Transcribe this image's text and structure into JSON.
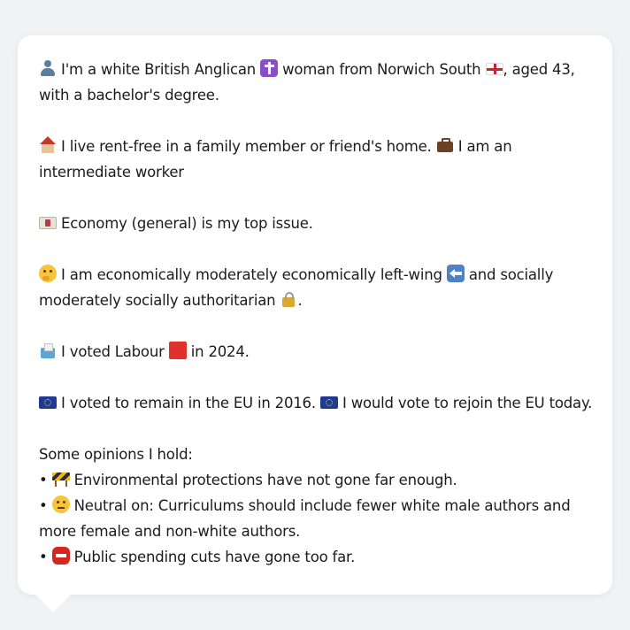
{
  "profile": {
    "identity": {
      "icon": "person-icon",
      "text_a": "I'm a white British Anglican",
      "religion_icon": "latin-cross-icon",
      "text_b": "woman from Norwich South",
      "flag_icon": "england-flag-icon",
      "text_c": ", aged 43, with a bachelor's degree."
    },
    "housing": {
      "icon": "house-icon",
      "text_a": "I live rent-free in a family member or friend's home.",
      "work_icon": "briefcase-icon",
      "text_b": "I am an intermediate worker"
    },
    "issue": {
      "icon": "money-icon",
      "text": "Economy (general) is my top issue."
    },
    "ideology": {
      "icon": "thinking-face-icon",
      "text_a": "I am economically moderately economically left-wing",
      "left_icon": "left-arrow-icon",
      "text_b": "and socially moderately socially authoritarian",
      "lock_icon": "lock-icon",
      "text_c": "."
    },
    "vote": {
      "icon": "ballot-box-icon",
      "text_a": "I voted Labour",
      "party_icon": "red-square-icon",
      "text_b": "in 2024."
    },
    "eu": {
      "icon": "eu-flag-icon",
      "text_a": "I voted to remain in the EU in 2016.",
      "icon2": "eu-flag-icon",
      "text_b": "I would vote to rejoin the EU today."
    },
    "opinions": {
      "heading": "Some opinions I hold:",
      "bullet": "•",
      "items": [
        {
          "icon": "construction-icon",
          "text": "Environmental protections have not gone far enough."
        },
        {
          "icon": "neutral-face-icon",
          "text": "Neutral on: Curriculums should include fewer white male authors and more female and non-white authors."
        },
        {
          "icon": "stop-sign-icon",
          "text": "Public spending cuts have gone too far."
        }
      ]
    }
  },
  "colors": {
    "background": "#f1f2f4",
    "card": "#ffffff",
    "text": "#1b1b1b"
  }
}
